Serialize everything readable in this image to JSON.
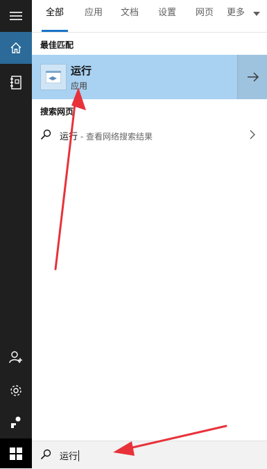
{
  "tabs": [
    {
      "label": "全部",
      "active": true
    },
    {
      "label": "应用"
    },
    {
      "label": "文档"
    },
    {
      "label": "设置"
    },
    {
      "label": "网页"
    },
    {
      "label": "更多"
    }
  ],
  "best_match": {
    "heading": "最佳匹配",
    "title": "运行",
    "subtitle": "应用"
  },
  "web": {
    "heading": "搜索网页",
    "query": "运行",
    "suffix": " - 查看网络搜索结果"
  },
  "search": {
    "value": "运行"
  },
  "rail_icons": [
    "hamburger-icon",
    "home-icon",
    "notebook-icon",
    "person-add-icon",
    "gear-icon",
    "feedback-icon",
    "windows-logo-icon"
  ],
  "colors": {
    "accent": "#1a73c8",
    "highlight": "#a9d1f1",
    "annotation": "#e8323a",
    "rail": "#1f1f1f"
  }
}
